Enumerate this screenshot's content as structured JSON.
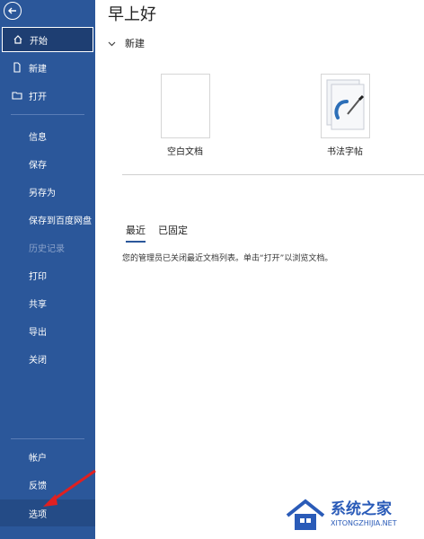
{
  "sidebar": {
    "items": [
      {
        "label": "开始",
        "icon": "home-icon"
      },
      {
        "label": "新建",
        "icon": "new-document-icon"
      },
      {
        "label": "打开",
        "icon": "open-folder-icon"
      },
      {
        "label": "信息"
      },
      {
        "label": "保存"
      },
      {
        "label": "另存为"
      },
      {
        "label": "保存到百度网盘"
      },
      {
        "label": "历史记录"
      },
      {
        "label": "打印"
      },
      {
        "label": "共享"
      },
      {
        "label": "导出"
      },
      {
        "label": "关闭"
      }
    ],
    "bottom_items": [
      {
        "label": "帐户"
      },
      {
        "label": "反馈"
      },
      {
        "label": "选项"
      }
    ]
  },
  "main": {
    "greeting": "早上好",
    "new_section": {
      "title": "新建",
      "templates": [
        {
          "label": "空白文档"
        },
        {
          "label": "书法字帖"
        }
      ]
    },
    "tabs": [
      {
        "label": "最近"
      },
      {
        "label": "已固定"
      }
    ],
    "notice": "您的管理员已关闭最近文档列表。单击“打开”以浏览文档。"
  },
  "watermark": {
    "name": "系统之家",
    "url": "XITONGZHIJIA.NET"
  },
  "colors": {
    "sidebar": "#2b579a",
    "sidebar_active": "#1e3e72",
    "annotation_arrow": "#e02020"
  }
}
